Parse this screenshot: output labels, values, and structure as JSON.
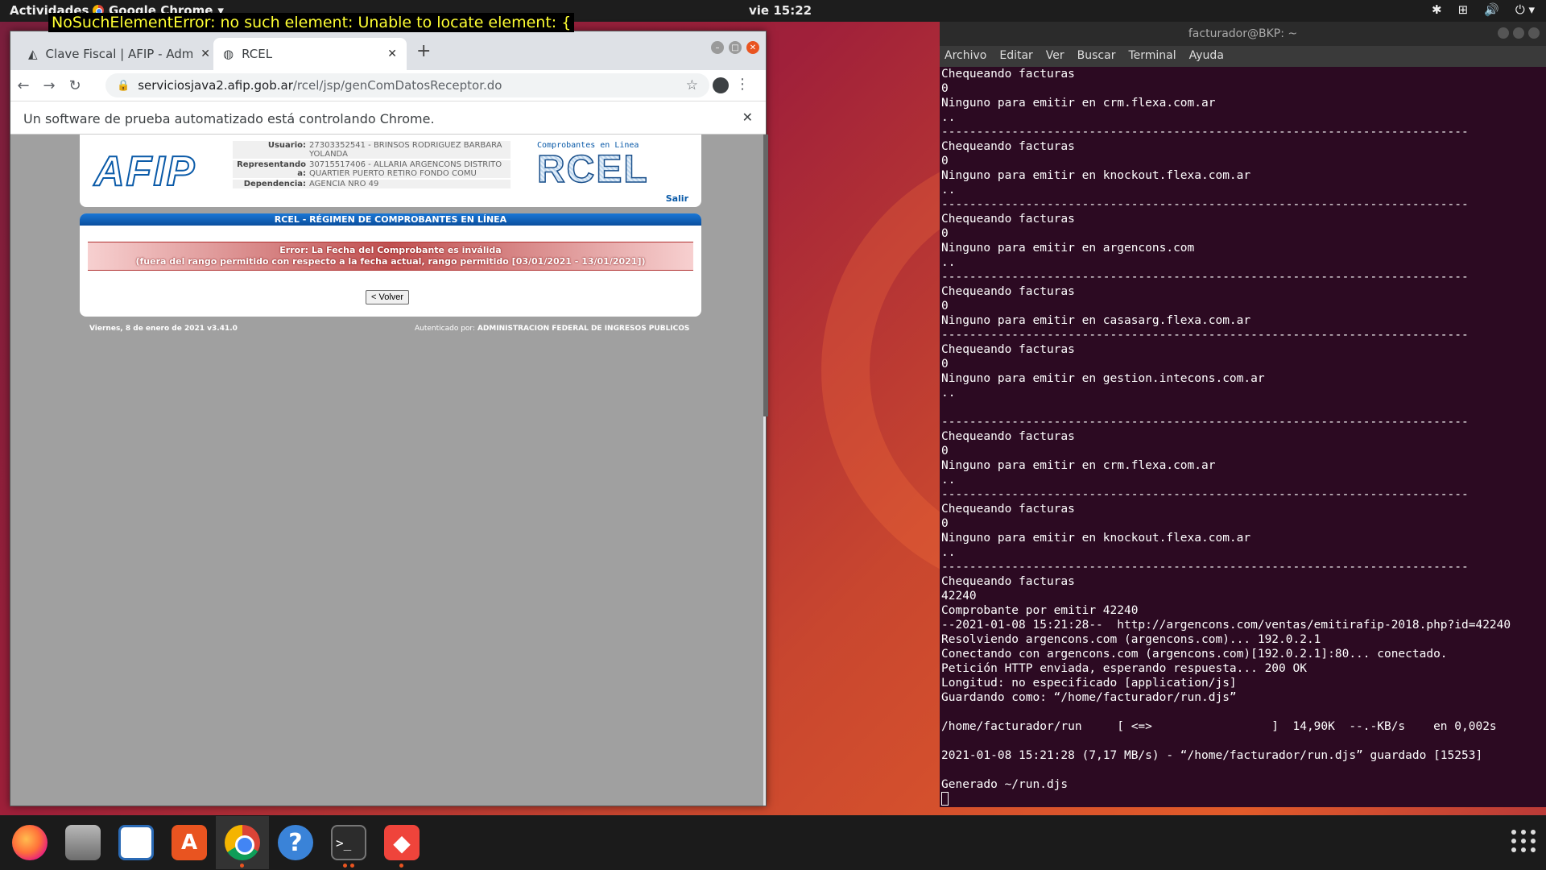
{
  "topbar": {
    "activities": "Actividades",
    "app_menu": "Google Chrome",
    "clock": "vie 15:22"
  },
  "overlay": {
    "error_text": "NoSuchElementError: no such element: Unable to locate element: {"
  },
  "chrome": {
    "tabs": [
      {
        "label": "Clave Fiscal | AFIP - Admin"
      },
      {
        "label": "RCEL"
      }
    ],
    "url_host": "serviciosjava2.afip.gob.ar",
    "url_path": "/rcel/jsp/genComDatosReceptor.do",
    "infobar_text": "Un software de prueba automatizado está controlando Chrome."
  },
  "afip": {
    "logo_text": "AFIP",
    "usuario_label": "Usuario:",
    "usuario_value": "27303352541 - BRINSOS RODRIGUEZ BARBARA YOLANDA",
    "representando_label": "Representando a:",
    "representando_value": "30715517406 - ALLARIA ARGENCONS DISTRITO QUARTIER PUERTO RETIRO FONDO COMU",
    "dependencia_label": "Dependencia:",
    "dependencia_value": "AGENCIA NRO 49",
    "rcel_subtitle": "Comprobantes en Linea",
    "rcel_logo": "RCEL",
    "salir": "Salir",
    "panel_title": "RCEL - RÉGIMEN DE COMPROBANTES EN LÍNEA",
    "error_line1": "Error: La Fecha del Comprobante es inválida",
    "error_line2": "(fuera del rango permitido con respecto a la fecha actual, rango permitido [03/01/2021 - 13/01/2021])",
    "volver": "< Volver",
    "footer_date": "Viernes, 8 de enero de 2021 v3.41.0",
    "footer_auth_label": "Autenticado por:",
    "footer_auth_value": "ADMINISTRACION FEDERAL DE INGRESOS PUBLICOS"
  },
  "terminal": {
    "title": "facturador@BKP: ~",
    "menu": [
      "Archivo",
      "Editar",
      "Ver",
      "Buscar",
      "Terminal",
      "Ayuda"
    ],
    "lines": [
      "Chequeando facturas",
      "0",
      "Ninguno para emitir en crm.flexa.com.ar",
      "..",
      "---------------------------------------------------------------------------",
      "Chequeando facturas",
      "0",
      "Ninguno para emitir en knockout.flexa.com.ar",
      "..",
      "---------------------------------------------------------------------------",
      "Chequeando facturas",
      "0",
      "Ninguno para emitir en argencons.com",
      "..",
      "---------------------------------------------------------------------------",
      "Chequeando facturas",
      "0",
      "Ninguno para emitir en casasarg.flexa.com.ar",
      "---------------------------------------------------------------------------",
      "Chequeando facturas",
      "0",
      "Ninguno para emitir en gestion.intecons.com.ar",
      "..",
      "",
      "---------------------------------------------------------------------------",
      "Chequeando facturas",
      "0",
      "Ninguno para emitir en crm.flexa.com.ar",
      "..",
      "---------------------------------------------------------------------------",
      "Chequeando facturas",
      "0",
      "Ninguno para emitir en knockout.flexa.com.ar",
      "..",
      "---------------------------------------------------------------------------",
      "Chequeando facturas",
      "42240",
      "Comprobante por emitir 42240",
      "--2021-01-08 15:21:28--  http://argencons.com/ventas/emitirafip-2018.php?id=42240",
      "Resolviendo argencons.com (argencons.com)... 192.0.2.1",
      "Conectando con argencons.com (argencons.com)[192.0.2.1]:80... conectado.",
      "Petición HTTP enviada, esperando respuesta... 200 OK",
      "Longitud: no especificado [application/js]",
      "Guardando como: “/home/facturador/run.djs”",
      "",
      "/home/facturador/run     [ <=>                 ]  14,90K  --.-KB/s    en 0,002s",
      "",
      "2021-01-08 15:21:28 (7,17 MB/s) - “/home/facturador/run.djs” guardado [15253]",
      "",
      "Generado ~/run.djs"
    ]
  },
  "dock": {
    "icons": [
      "firefox-icon",
      "files-icon",
      "writer-icon",
      "software-icon",
      "chrome-icon",
      "help-icon",
      "terminal-icon",
      "anydesk-icon"
    ]
  }
}
